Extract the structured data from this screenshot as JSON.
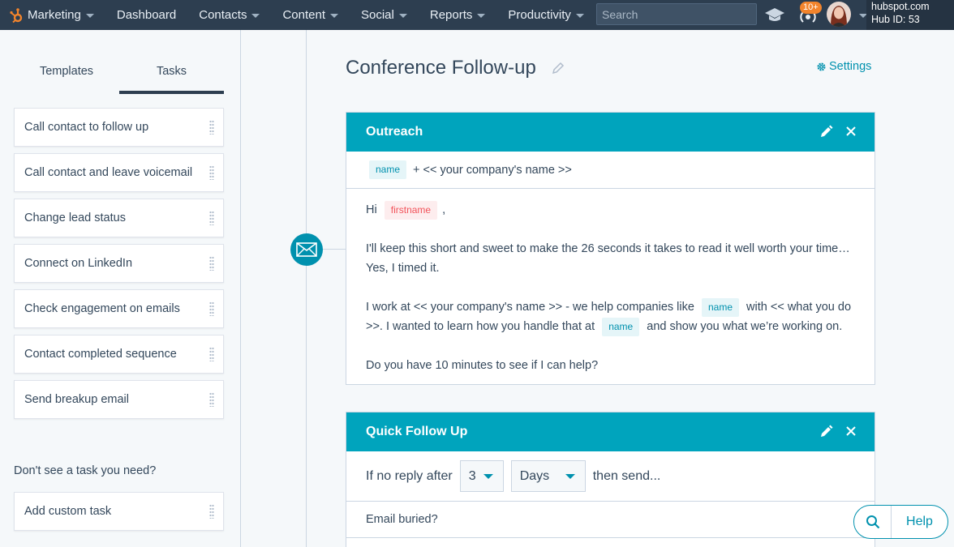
{
  "topnav": {
    "brand_label": "Marketing",
    "items": [
      {
        "label": "Dashboard",
        "has_caret": false
      },
      {
        "label": "Contacts",
        "has_caret": true
      },
      {
        "label": "Content",
        "has_caret": true
      },
      {
        "label": "Social",
        "has_caret": true
      },
      {
        "label": "Reports",
        "has_caret": true
      },
      {
        "label": "Productivity",
        "has_caret": true
      }
    ],
    "search_placeholder": "Search",
    "notification_count": "10+",
    "portal_domain": "hubspot.com",
    "portal_hub_id": "Hub ID: 53"
  },
  "sidebar": {
    "tabs": [
      "Templates",
      "Tasks"
    ],
    "active_tab": "Tasks",
    "tasks": [
      "Call contact to follow up",
      "Call contact and leave voicemail",
      "Change lead status",
      "Connect on LinkedIn",
      "Check engagement on emails",
      "Contact completed sequence",
      "Send breakup email"
    ],
    "prompt": "Don't see a task you need?",
    "custom_task": "Add custom task"
  },
  "main": {
    "title": "Conference Follow-up",
    "settings_label": "Settings",
    "outreach": {
      "header": "Outreach",
      "subject_token": "name",
      "subject_text": "+ << your company's name >>",
      "greeting": "Hi",
      "greeting_token": "firstname",
      "greeting_suffix": ",",
      "para1": "I'll keep this short and sweet to make the 26 seconds it takes to read it well worth your time… Yes, I timed it.",
      "para2_a": "I work at << your company's name >> - we help companies like",
      "para2_token1": "name",
      "para2_b": "with << what you do >>. I wanted to learn how you handle that at",
      "para2_token2": "name",
      "para2_c": "and show you what we’re working on.",
      "para3": "Do you have 10 minutes to see if I can help?"
    },
    "quick_follow_up": {
      "header": "Quick Follow Up",
      "prefix": "If no reply after",
      "delay_value": "3",
      "delay_unit": "Days",
      "suffix": "then send...",
      "subject": "Email buried?"
    }
  },
  "help": {
    "label": "Help"
  },
  "colors": {
    "nav_bg": "#2d3e50",
    "accent": "#00a4bd",
    "link": "#0091ae",
    "brand_orange": "#f2842c"
  }
}
